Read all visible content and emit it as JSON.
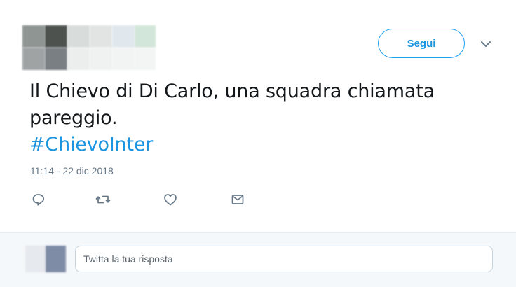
{
  "tweet": {
    "follow_label": "Segui",
    "text_line1": "Il Chievo di Di Carlo, una squadra chiamata",
    "text_line2": "pareggio.",
    "hashtag": "#ChievoInter",
    "timestamp": "11:14 - 22 dic 2018"
  },
  "actions": [
    "reply-icon",
    "retweet-icon",
    "like-icon",
    "direct-message-icon"
  ],
  "reply": {
    "placeholder": "Twitta la tua risposta"
  },
  "colors": {
    "accent": "#1da1f2",
    "link": "#1b95e0",
    "text": "#14171a",
    "muted": "#657786",
    "reply_bg": "#f5f8fa"
  }
}
